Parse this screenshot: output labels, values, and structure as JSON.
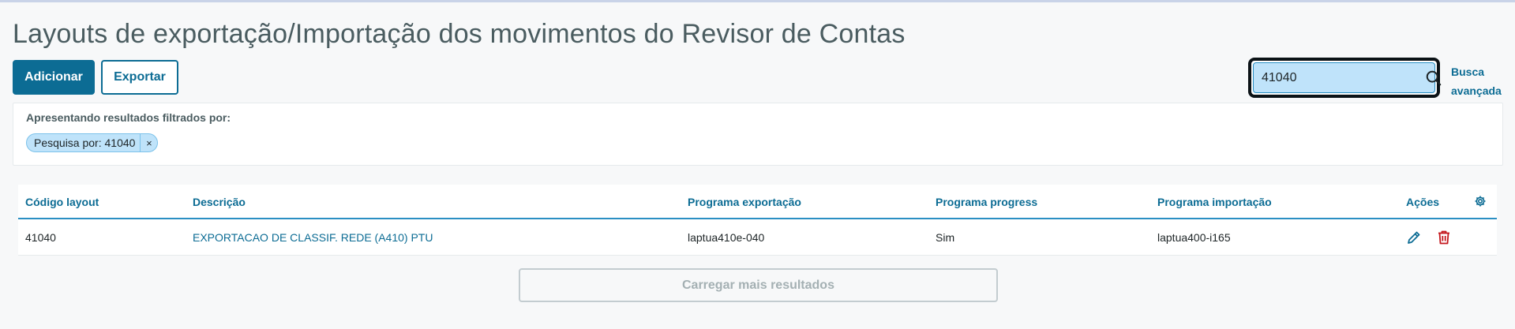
{
  "page": {
    "title": "Layouts de exportação/Importação dos movimentos do Revisor de Contas"
  },
  "toolbar": {
    "add_label": "Adicionar",
    "export_label": "Exportar"
  },
  "search": {
    "value": "41040",
    "icon": "search-icon",
    "advanced_label_line1": "Busca",
    "advanced_label_line2": "avançada"
  },
  "filters": {
    "label": "Apresentando resultados filtrados por:",
    "chips": [
      {
        "text": "Pesquisa por: 41040",
        "close": "×"
      }
    ]
  },
  "table": {
    "columns": [
      "Código layout",
      "Descrição",
      "Programa exportação",
      "Programa progress",
      "Programa importação",
      "Ações"
    ],
    "rows": [
      {
        "codigo": "41040",
        "descricao": "EXPORTACAO DE CLASSIF. REDE (A410) PTU",
        "exportacao": "laptua410e-040",
        "progress": "Sim",
        "importacao": "laptua400-i165"
      }
    ],
    "settings_icon": "gear-icon",
    "actions_icons": [
      "edit-icon",
      "delete-icon"
    ]
  },
  "load_more_label": "Carregar mais resultados",
  "colors": {
    "primary": "#0c6c94",
    "search_bg": "#bfe3fa",
    "delete": "#c4161c"
  }
}
